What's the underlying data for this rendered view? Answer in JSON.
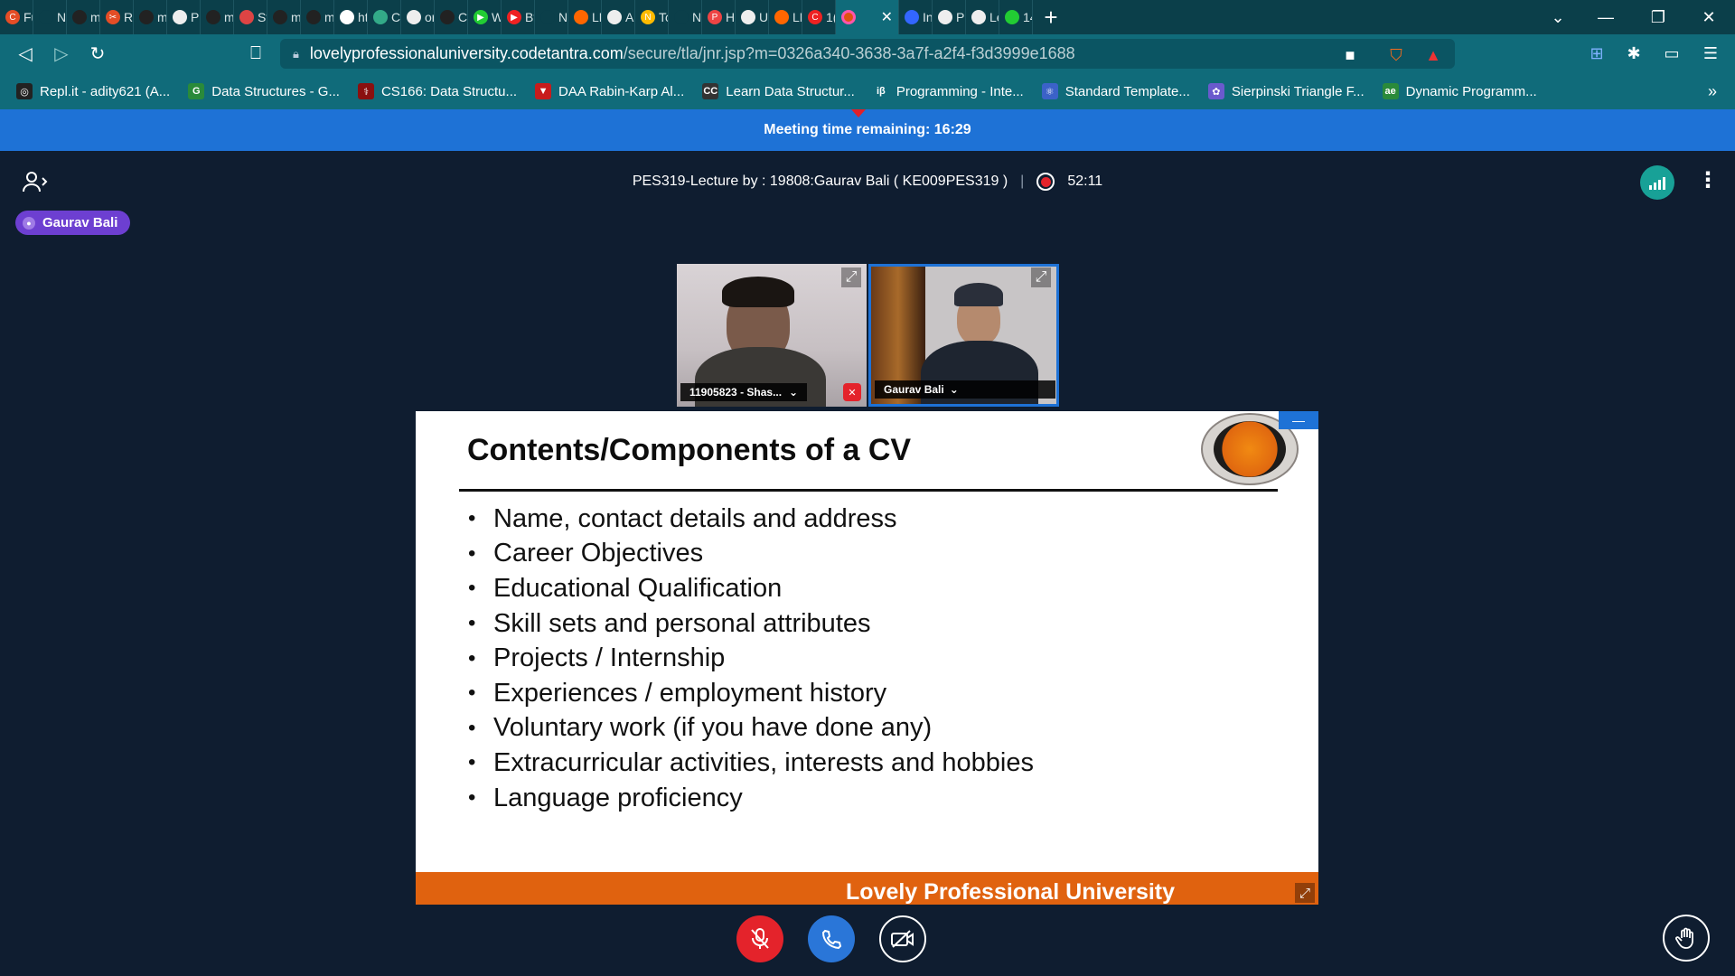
{
  "tabs": [
    {
      "label": "Fu",
      "color": "#e44d26",
      "glyph": "C"
    },
    {
      "label": "New T",
      "color": "#0b3f4a",
      "glyph": ""
    },
    {
      "label": "m",
      "color": "#222",
      "glyph": ""
    },
    {
      "label": "Rc",
      "color": "#e44d26",
      "glyph": "✂"
    },
    {
      "label": "m",
      "color": "#222",
      "glyph": ""
    },
    {
      "label": "Pl",
      "color": "#eee",
      "glyph": ""
    },
    {
      "label": "m",
      "color": "#222",
      "glyph": ""
    },
    {
      "label": "Sv",
      "color": "#d44",
      "glyph": ""
    },
    {
      "label": "m",
      "color": "#222",
      "glyph": ""
    },
    {
      "label": "m",
      "color": "#222",
      "glyph": ""
    },
    {
      "label": "ht",
      "color": "#fff",
      "glyph": "▲"
    },
    {
      "label": "Ca",
      "color": "#3a8",
      "glyph": ""
    },
    {
      "label": "or",
      "color": "#eee",
      "glyph": ""
    },
    {
      "label": "Cc",
      "color": "#222",
      "glyph": ""
    },
    {
      "label": "W",
      "color": "#2c3",
      "glyph": "▶"
    },
    {
      "label": "Bt",
      "color": "#e22",
      "glyph": "▶"
    },
    {
      "label": "New T",
      "color": "#0b3f4a",
      "glyph": ""
    },
    {
      "label": "LF",
      "color": "#f60",
      "glyph": ""
    },
    {
      "label": "A",
      "color": "#eee",
      "glyph": ""
    },
    {
      "label": "Tc",
      "color": "#fb0",
      "glyph": "N"
    },
    {
      "label": "New T",
      "color": "#0b3f4a",
      "glyph": ""
    },
    {
      "label": "H",
      "color": "#e44",
      "glyph": "P"
    },
    {
      "label": "Ul",
      "color": "#eee",
      "glyph": ""
    },
    {
      "label": "LF",
      "color": "#f60",
      "glyph": ""
    },
    {
      "label": "1(",
      "color": "#e22",
      "glyph": "C"
    }
  ],
  "active_tab": {
    "label": "",
    "close": "✕"
  },
  "tabs_after": [
    {
      "label": "In",
      "color": "#36f",
      "glyph": ""
    },
    {
      "label": "Pr",
      "color": "#eee",
      "glyph": ""
    },
    {
      "label": "Le",
      "color": "#eee",
      "glyph": ""
    },
    {
      "label": "14",
      "color": "#2c3",
      "glyph": ""
    }
  ],
  "window": {
    "newtab": "+",
    "minimize": "—",
    "restore": "❐",
    "close": "✕",
    "dropdown": "⌄"
  },
  "url": {
    "host": "lovelyprofessionaluniversity.codetantra.com",
    "path": "/secure/tla/jnr.jsp?m=0326a340-3638-3a7f-a2f4-f3d3999e1688"
  },
  "bookmarks": [
    {
      "label": "Repl.it - adity621 (A...",
      "color": "#222",
      "glyph": "◎"
    },
    {
      "label": "Data Structures - G...",
      "color": "#2a8a3a",
      "glyph": "G"
    },
    {
      "label": "CS166: Data Structu...",
      "color": "#8a1010",
      "glyph": "⚕"
    },
    {
      "label": "DAA Rabin-Karp Al...",
      "color": "#c81c1c",
      "glyph": "▼"
    },
    {
      "label": "Learn Data Structur...",
      "color": "#333",
      "glyph": "CC"
    },
    {
      "label": "Programming - Inte...",
      "color": "#106b7a",
      "glyph": "iβ"
    },
    {
      "label": "Standard Template...",
      "color": "#3b62c8",
      "glyph": "⚛"
    },
    {
      "label": "Sierpinski Triangle F...",
      "color": "#6a5acd",
      "glyph": "✿"
    },
    {
      "label": "Dynamic Programm...",
      "color": "#2a8a3a",
      "glyph": "ae"
    }
  ],
  "bookmarks_more": "»",
  "banner": {
    "text": "Meeting time remaining: 16:29"
  },
  "meeting": {
    "title": "PES319-Lecture by : 19808:Gaurav Bali ( KE009PES319 )",
    "separator": "|",
    "elapsed": "52:11",
    "speaker": "Gaurav Bali"
  },
  "tiles": [
    {
      "name": "11905823 - Shas...",
      "caret": "⌄"
    },
    {
      "name": "Gaurav Bali",
      "caret": "⌄"
    }
  ],
  "slide": {
    "title": "Contents/Components of a CV",
    "items": [
      "Name, contact details and address",
      "Career Objectives",
      "Educational Qualification",
      "Skill sets and personal attributes",
      "Projects / Internship",
      "Experiences / employment history",
      "Voluntary work (if you have done any)",
      "Extracurricular activities, interests and hobbies",
      "Language proficiency"
    ],
    "footer": "Lovely Professional University",
    "minimize": "—"
  },
  "colors": {
    "banner": "#1e72d6",
    "footer": "#e0620f",
    "mic_muted": "#e4232b",
    "phone": "#2a76d8",
    "speaker_pill": "#6d3fd1"
  }
}
